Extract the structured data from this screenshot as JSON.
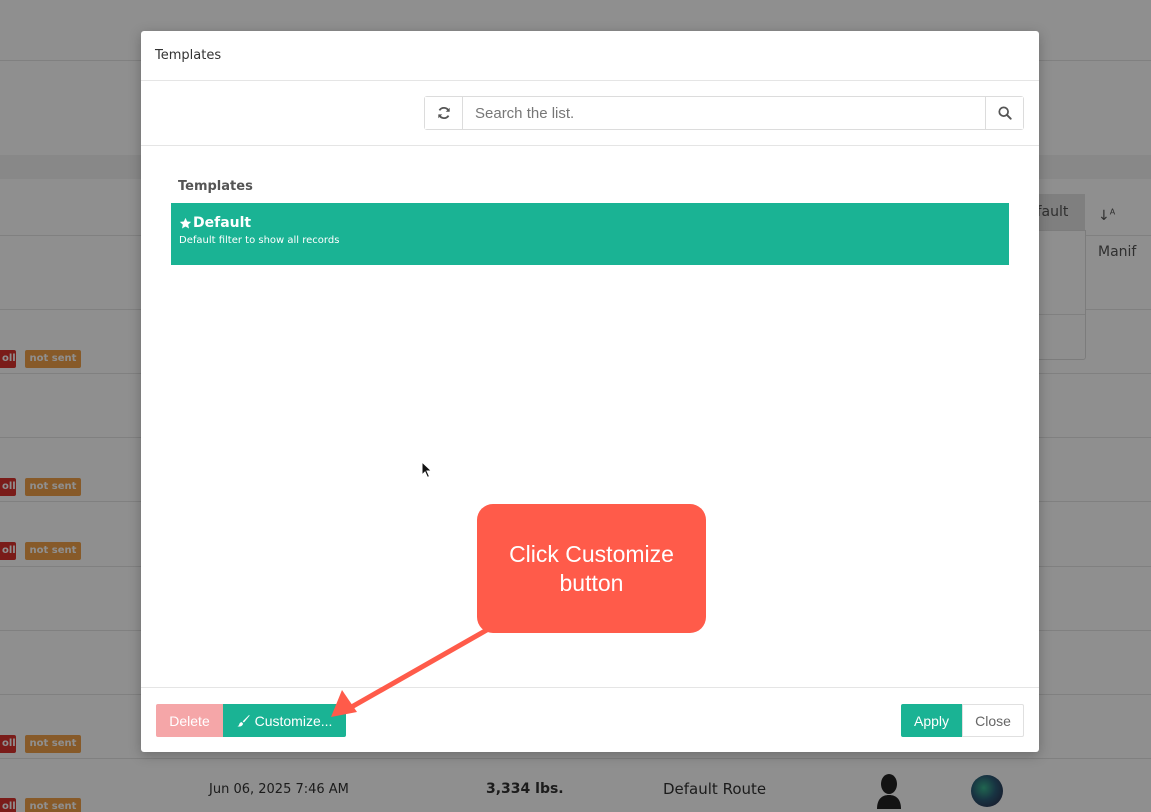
{
  "background": {
    "tags": [
      {
        "text": "oll",
        "kind": "red"
      },
      {
        "text": "not sent",
        "kind": "orange"
      },
      {
        "text": "oll",
        "kind": "red"
      },
      {
        "text": "not sent",
        "kind": "orange"
      },
      {
        "text": "oll",
        "kind": "red"
      },
      {
        "text": "not sent",
        "kind": "orange"
      },
      {
        "text": "oll",
        "kind": "red"
      },
      {
        "text": "not sent",
        "kind": "orange"
      },
      {
        "text": "oll",
        "kind": "red"
      },
      {
        "text": "not sent",
        "kind": "orange"
      }
    ],
    "sort_button_label": "efault",
    "sort_manifest_label": "Manif",
    "last_row": {
      "date": "Jun 06, 2025 7:46 AM",
      "weight": "3,334 lbs.",
      "route": "Default Route"
    }
  },
  "modal": {
    "title": "Templates",
    "search_placeholder": "Search the list.",
    "list_heading": "Templates",
    "items": [
      {
        "title": "Default",
        "description": "Default filter to show all records",
        "icon": "star-icon",
        "selected": true
      }
    ],
    "footer": {
      "delete_label": "Delete",
      "customize_label": "Customize...",
      "apply_label": "Apply",
      "close_label": "Close"
    }
  },
  "callout": {
    "text": "Click Customize button"
  },
  "colors": {
    "accent": "#1ab394",
    "delete": "#f5a6a8",
    "callout": "#ff5b4a",
    "tag_red": "#d9322e",
    "tag_orange": "#f0a14a"
  }
}
